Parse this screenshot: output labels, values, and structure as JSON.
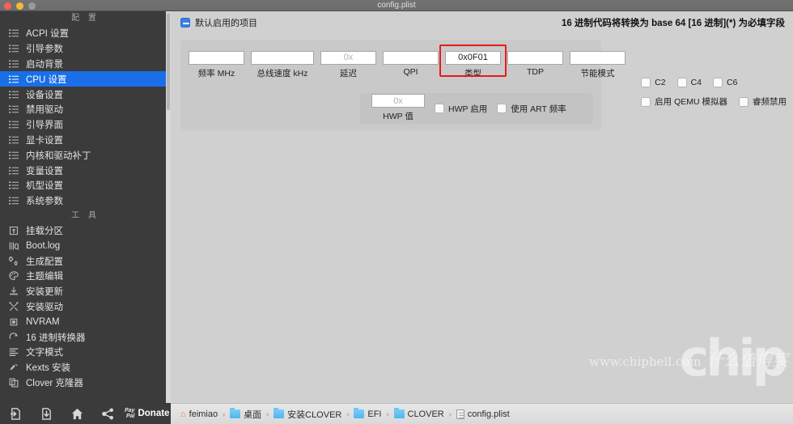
{
  "window": {
    "title": "config.plist"
  },
  "sidebar": {
    "config_section": "配 置",
    "tools_section": "工 具",
    "config_items": [
      {
        "label": "ACPI 设置",
        "icon": "list-icon",
        "active": false
      },
      {
        "label": "引导参数",
        "icon": "list-icon",
        "active": false
      },
      {
        "label": "启动背景",
        "icon": "list-icon",
        "active": false
      },
      {
        "label": "CPU 设置",
        "icon": "list-icon",
        "active": true
      },
      {
        "label": "设备设置",
        "icon": "list-icon",
        "active": false
      },
      {
        "label": "禁用驱动",
        "icon": "list-icon",
        "active": false
      },
      {
        "label": "引导界面",
        "icon": "list-icon",
        "active": false
      },
      {
        "label": "显卡设置",
        "icon": "list-icon",
        "active": false
      },
      {
        "label": "内核和驱动补丁",
        "icon": "list-icon",
        "active": false
      },
      {
        "label": "变量设置",
        "icon": "list-icon",
        "active": false
      },
      {
        "label": "机型设置",
        "icon": "list-icon",
        "active": false
      },
      {
        "label": "系统参数",
        "icon": "list-icon",
        "active": false
      }
    ],
    "tool_items": [
      {
        "label": "挂载分区",
        "icon": "disk-mount-icon",
        "active": false
      },
      {
        "label": "Boot.log",
        "icon": "log-search-icon",
        "active": false
      },
      {
        "label": "生成配置",
        "icon": "gears-icon",
        "active": false
      },
      {
        "label": "主题编辑",
        "icon": "palette-icon",
        "active": false
      },
      {
        "label": "安装更新",
        "icon": "download-icon",
        "active": false
      },
      {
        "label": "安装驱动",
        "icon": "tools-icon",
        "active": false
      },
      {
        "label": "NVRAM",
        "icon": "chip-icon",
        "active": false
      },
      {
        "label": "16 进制转换器",
        "icon": "refresh-icon",
        "active": false
      },
      {
        "label": "文字模式",
        "icon": "text-lines-icon",
        "active": false
      },
      {
        "label": "Kexts 安装",
        "icon": "plug-icon",
        "active": false
      },
      {
        "label": "Clover 克隆器",
        "icon": "copy-icon",
        "active": false
      }
    ]
  },
  "toolbar": {
    "buttons": [
      {
        "name": "import-button",
        "icon": "import-arrow-icon"
      },
      {
        "name": "export-button",
        "icon": "export-arrow-icon"
      },
      {
        "name": "home-button",
        "icon": "home-icon"
      },
      {
        "name": "share-button",
        "icon": "share-icon"
      }
    ],
    "paypal_line1": "Pay",
    "paypal_line2": "Pal",
    "donate_label": "Donate"
  },
  "breadcrumb": {
    "separator": "›",
    "items": [
      {
        "label": "feimiao",
        "icon": "home-icon"
      },
      {
        "label": "桌面",
        "icon": "folder-icon"
      },
      {
        "label": "安装CLOVER",
        "icon": "folder-icon"
      },
      {
        "label": "EFI",
        "icon": "folder-icon"
      },
      {
        "label": "CLOVER",
        "icon": "folder-icon"
      },
      {
        "label": "config.plist",
        "icon": "file-icon"
      }
    ]
  },
  "main": {
    "default_enabled_label": "默认启用的项目",
    "hex_note": "16 进制代码将转换为 base 64 [16 进制](*) 为必填字段",
    "fields": [
      {
        "name": "frequency",
        "caption": "频率 MHz",
        "value": "",
        "placeholder": ""
      },
      {
        "name": "bus-speed",
        "caption": "总线速度 kHz",
        "value": "",
        "placeholder": ""
      },
      {
        "name": "latency",
        "caption": "延迟",
        "value": "",
        "placeholder": "0x"
      },
      {
        "name": "qpi",
        "caption": "QPI",
        "value": "",
        "placeholder": ""
      },
      {
        "name": "type",
        "caption": "类型",
        "value": "0x0F01",
        "placeholder": "",
        "highlighted": true
      },
      {
        "name": "tdp",
        "caption": "TDP",
        "value": "",
        "placeholder": ""
      },
      {
        "name": "power-mode",
        "caption": "节能模式",
        "value": "",
        "placeholder": ""
      }
    ],
    "hwp": {
      "caption": "HWP 值",
      "value": "",
      "placeholder": "0x",
      "enable_label": "HWP 启用",
      "enable_checked": false,
      "art_label": "使用 ART 频率",
      "art_checked": false
    },
    "right_checkboxes": {
      "row1": [
        {
          "label": "C2",
          "checked": false
        },
        {
          "label": "C4",
          "checked": false
        },
        {
          "label": "C6",
          "checked": false
        }
      ],
      "row2": [
        {
          "label": "启用 QEMU 模拟器",
          "checked": false
        },
        {
          "label": "睿频禁用",
          "checked": false
        }
      ]
    }
  },
  "watermark": {
    "logo": "chip",
    "url": "www.chiphell.com",
    "cn": "什么值得买"
  },
  "colors": {
    "sidebar_bg": "#3b3b3b",
    "accent_blue": "#1a6fe8",
    "highlight_red": "#e81b18",
    "panel_bg": "#c9c9c9",
    "main_bg": "#d0d0d0"
  }
}
